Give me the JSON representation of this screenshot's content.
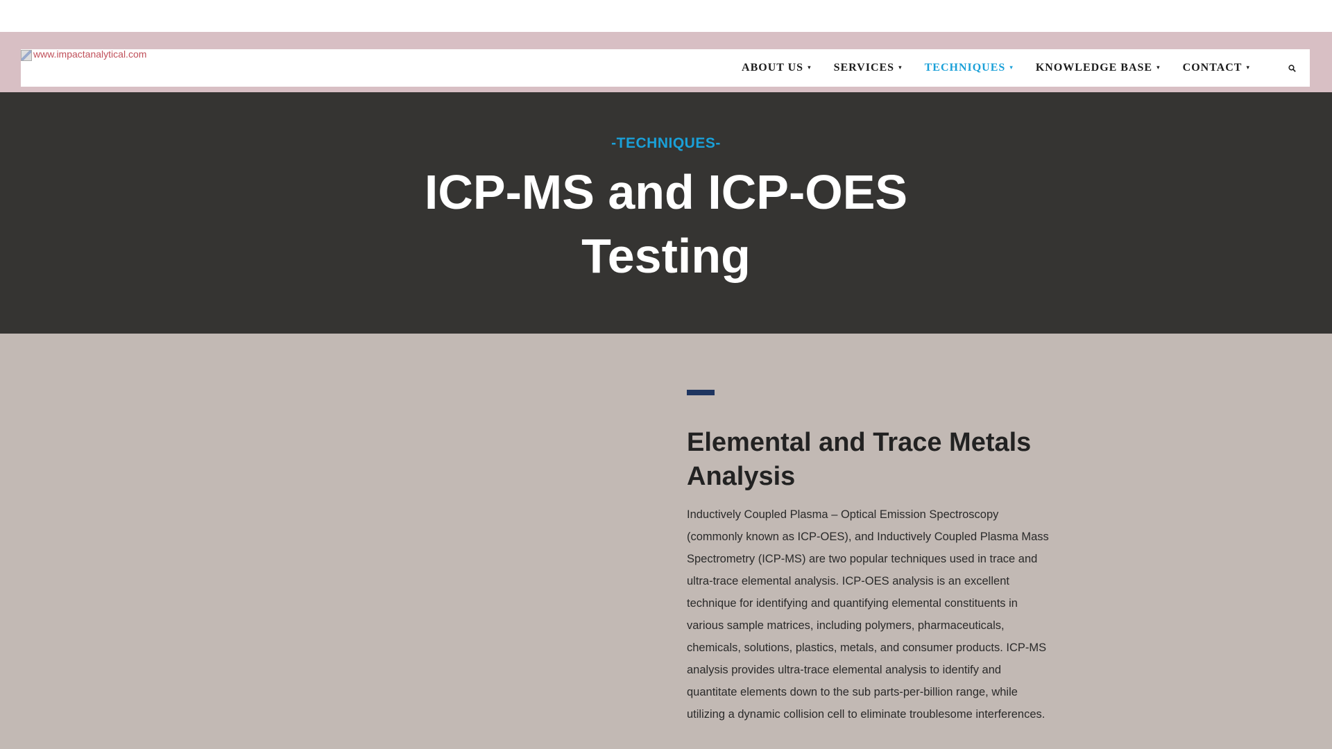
{
  "header": {
    "logo_alt": "www.impactanalytical.com",
    "nav": [
      {
        "label": "ABOUT US",
        "active": false
      },
      {
        "label": "SERVICES",
        "active": false
      },
      {
        "label": "TECHNIQUES",
        "active": true
      },
      {
        "label": "KNOWLEDGE BASE",
        "active": false
      },
      {
        "label": "CONTACT",
        "active": false
      }
    ],
    "search_icon": "search-icon"
  },
  "hero": {
    "eyebrow": "-TECHNIQUES-",
    "title": "ICP-MS and ICP-OES Testing"
  },
  "section": {
    "title": "Elemental and Trace Metals Analysis",
    "body": "Inductively Coupled Plasma – Optical Emission Spectroscopy (commonly known as ICP-OES), and Inductively Coupled Plasma Mass Spectrometry (ICP-MS) are two popular techniques used in trace and ultra-trace elemental analysis. ICP-OES analysis is an excellent technique for identifying and quantifying elemental constituents in various sample matrices, including polymers, pharmaceuticals, chemicals, solutions, plastics, metals, and consumer products. ICP-MS analysis provides ultra-trace elemental analysis to identify and quantitate elements down to the sub parts-per-billion range, while utilizing a dynamic collision cell to eliminate troublesome interferences."
  },
  "colors": {
    "accent": "#1aa0d8",
    "hero_bg": "#353432",
    "content_bg": "#c2b9b4",
    "band": "#d8bfc4",
    "bar": "#1e3560"
  }
}
